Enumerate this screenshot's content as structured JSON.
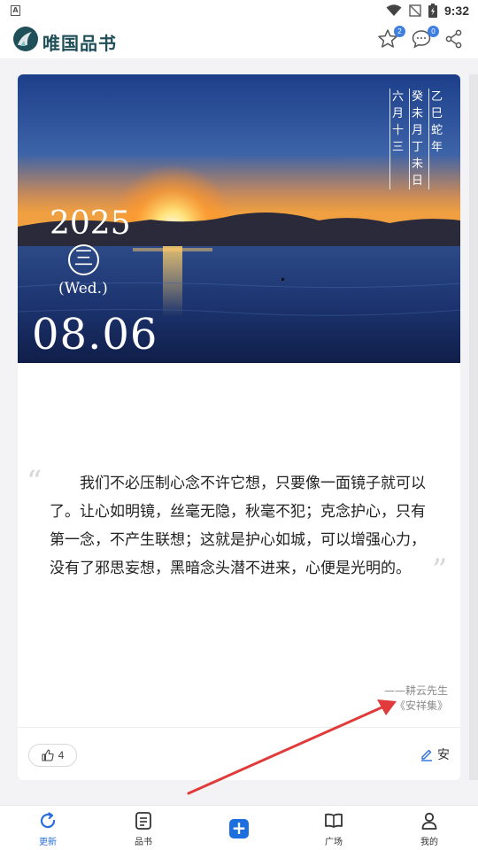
{
  "status_bar": {
    "time": "9:32"
  },
  "header": {
    "app_title": "唯国品书",
    "favorites_badge": "2",
    "messages_badge": "0"
  },
  "card": {
    "lunar": {
      "col1": "乙巳蛇年",
      "col2": "癸未月丁未日",
      "col3": "六月十三"
    },
    "year": "2025",
    "weekday_cn": "三",
    "weekday_en": "(Wed.)",
    "date": "08.06",
    "quote_open": "“",
    "quote_close": "”",
    "quote": "我们不必压制心念不许它想，只要像一面镜子就可以了。让心如明镜，丝毫无隐，秋毫不犯；克念护心，只有第一念，不产生联想；这就是护心如城，可以增强心力，没有了邪思妄想，黑暗念头潜不进来，心便是光明的。",
    "author": "——耕云先生",
    "source": "《安祥集》",
    "like_count": "4",
    "edit_label": "安"
  },
  "bottom_nav": {
    "items": [
      {
        "label": "更新",
        "icon": "refresh-icon",
        "active": true
      },
      {
        "label": "品书",
        "icon": "book-list-icon",
        "active": false
      },
      {
        "label": "广场",
        "icon": "open-book-icon",
        "active": false
      },
      {
        "label": "我的",
        "icon": "person-icon",
        "active": false
      }
    ],
    "center_icon": "plus-icon"
  },
  "colors": {
    "accent": "#2a6fd8",
    "annotation_arrow": "#e03a3a"
  }
}
